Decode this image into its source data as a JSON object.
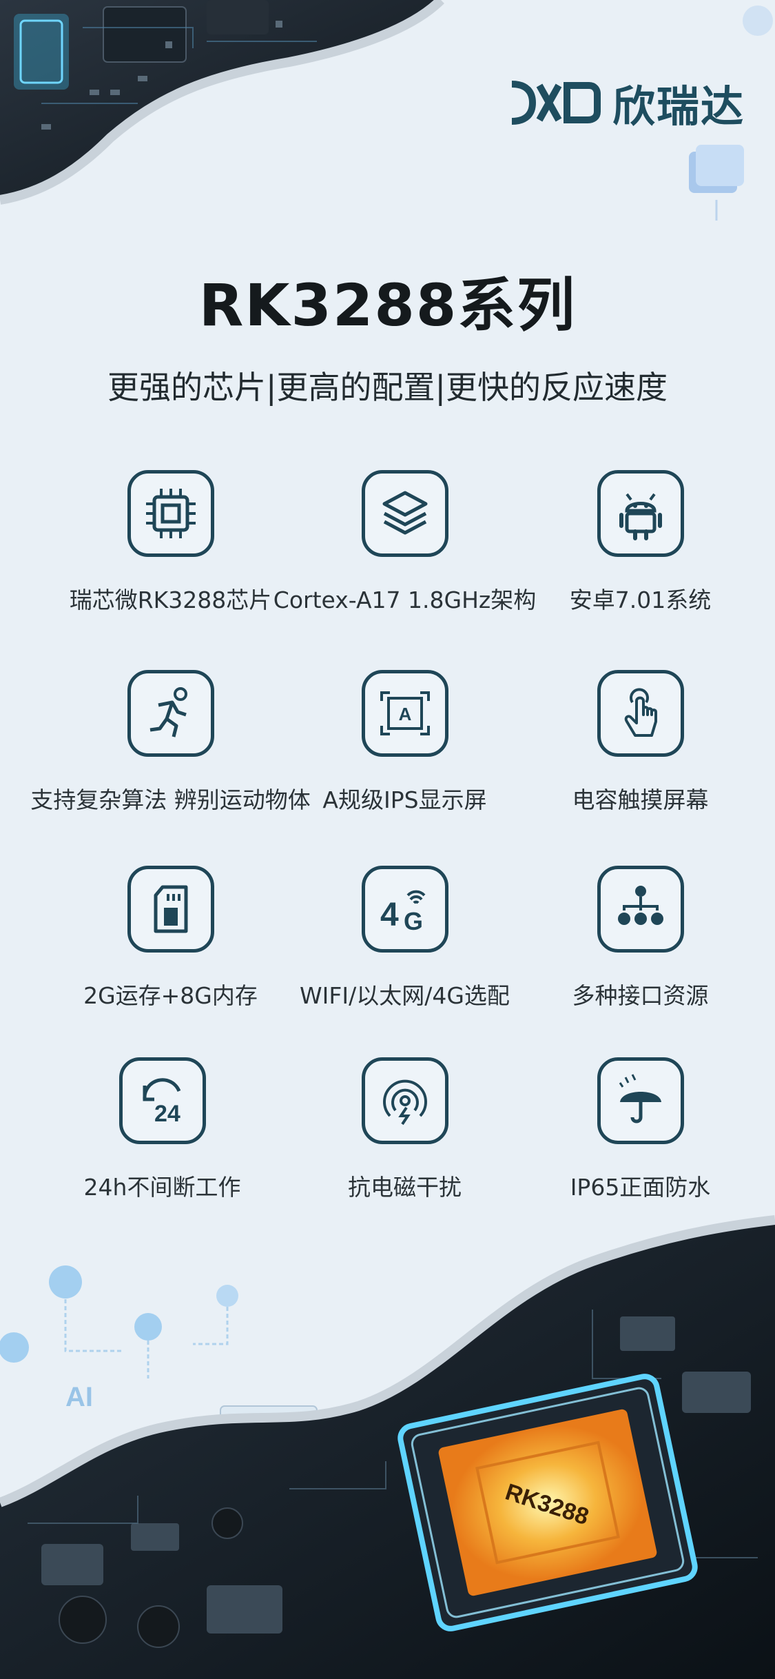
{
  "brand": {
    "logo_text": "欣瑞达",
    "mark_icon": "xrd-logo-mark-icon"
  },
  "title": "RK3288系列",
  "subtitle": "更强的芯片|更高的配置|更快的反应速度",
  "colors": {
    "accent": "#1f4657",
    "background": "#e9f0f6",
    "title": "#151a1d"
  },
  "features": [
    {
      "label": "瑞芯微RK3288芯片",
      "icon": "cpu-chip-icon"
    },
    {
      "label": "Cortex-A17 1.8GHz架构",
      "icon": "layers-icon"
    },
    {
      "label": "安卓7.01系统",
      "icon": "android-icon"
    },
    {
      "label": "支持复杂算法 辨别运动物体",
      "icon": "running-person-icon"
    },
    {
      "label": "A规级IPS显示屏",
      "icon": "a-grade-screen-icon"
    },
    {
      "label": "电容触摸屏幕",
      "icon": "touch-finger-icon"
    },
    {
      "label": "2G运存+8G内存",
      "icon": "sd-card-icon"
    },
    {
      "label": "WIFI/以太网/4G选配",
      "icon": "4g-signal-icon"
    },
    {
      "label": "多种接口资源",
      "icon": "network-hierarchy-icon"
    },
    {
      "label": "24h不间断工作",
      "icon": "24h-cycle-icon"
    },
    {
      "label": "抗电磁干扰",
      "icon": "anti-interference-icon"
    },
    {
      "label": "IP65正面防水",
      "icon": "umbrella-rain-icon"
    }
  ],
  "chip_marking": "RK3288",
  "ai_badge": "AI"
}
